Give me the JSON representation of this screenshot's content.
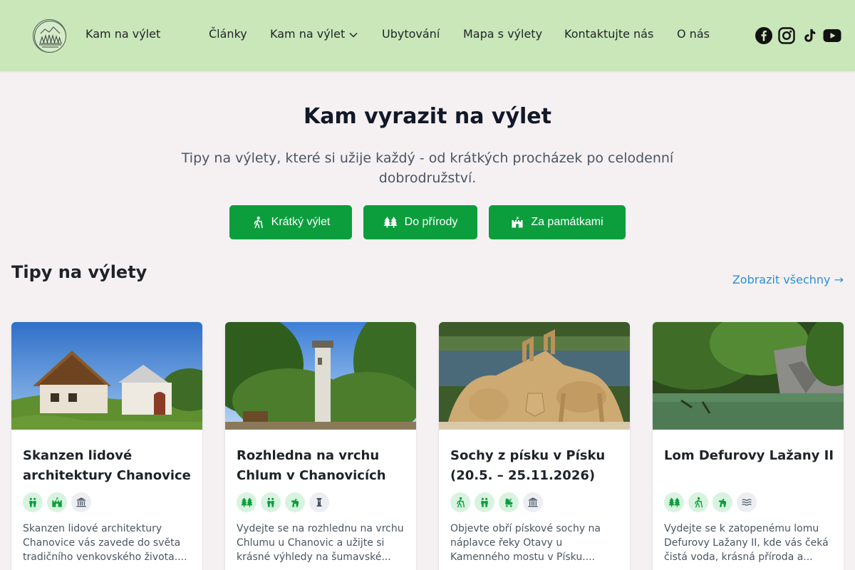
{
  "header": {
    "brand": "Kam na výlet",
    "nav": [
      {
        "label": "Články"
      },
      {
        "label": "Kam na výlet",
        "dropdown": true
      },
      {
        "label": "Ubytování"
      },
      {
        "label": "Mapa s výlety"
      },
      {
        "label": "Kontaktujte nás"
      },
      {
        "label": "O nás"
      }
    ],
    "social_icons": [
      "facebook-icon",
      "instagram-icon",
      "tiktok-icon",
      "youtube-icon"
    ]
  },
  "hero": {
    "title": "Kam vyrazit na výlet",
    "subtitle": "Tipy na výlety, které si užije každý - od krátkých procházek po celodenní dobrodružství.",
    "buttons": [
      {
        "label": "Krátký výlet",
        "icon": "hiker-icon"
      },
      {
        "label": "Do přírody",
        "icon": "trees-icon"
      },
      {
        "label": "Za památkami",
        "icon": "castle-icon"
      }
    ]
  },
  "section": {
    "title": "Tipy na výlety",
    "view_all": "Zobrazit všechny →"
  },
  "cards": [
    {
      "title": "Skanzen lidové architektury Chanovice",
      "tags": [
        "family-icon",
        "castle-icon",
        "museum-icon"
      ],
      "description": "Skanzen lidové architektury Chanovice vás zavede do světa tradičního venkovského života...."
    },
    {
      "title": "Rozhledna na vrchu Chlum v Chanovicích",
      "tags": [
        "trees-icon",
        "family-icon",
        "dog-friendly-icon",
        "tower-icon"
      ],
      "description": "Vydejte se na rozhlednu na vrchu Chlumu u Chanovic a užijte si krásné výhledy na šumavské..."
    },
    {
      "title": "Sochy z písku v Písku (20.5. – 25.11.2026)",
      "tags": [
        "hiker-icon",
        "family-icon",
        "stroller-icon",
        "museum-icon"
      ],
      "description": "Objevte obří pískové sochy na náplavce řeky Otavy u Kamenného mostu v Písku...."
    },
    {
      "title": "Lom Defurovy Lažany II",
      "tags": [
        "trees-icon",
        "hiker-icon",
        "dog-friendly-icon",
        "water-icon"
      ],
      "description": "Vydejte se k zatopenému lomu Defurovy Lažany II, kde vás čeká čistá voda, krásná příroda a..."
    }
  ],
  "colors": {
    "header_bg": "#c9e7b9",
    "page_bg": "#f5f1f3",
    "button_green": "#0c9e3d",
    "link_blue": "#2b8fd4",
    "tag_green_bg": "#d8f3df",
    "tag_icon_green": "#0c9e3d"
  }
}
